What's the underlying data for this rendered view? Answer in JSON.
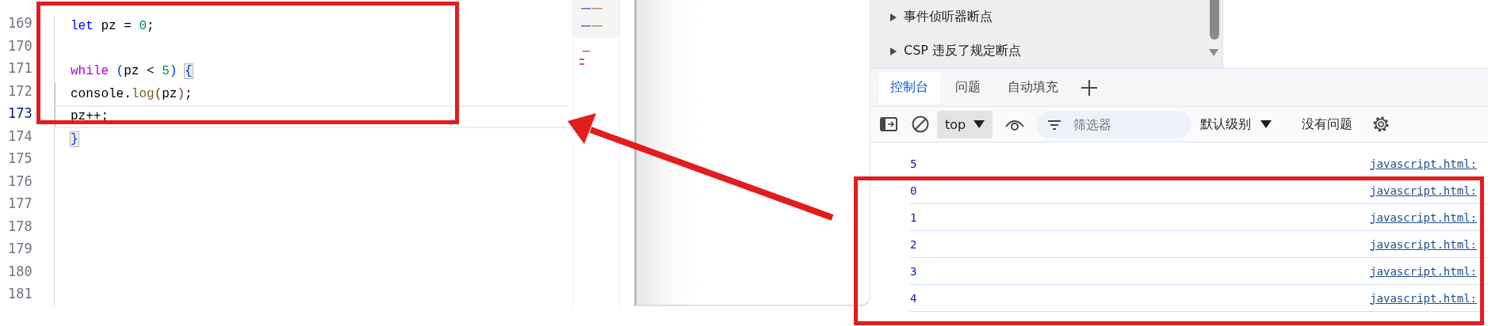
{
  "editor": {
    "lines": [
      {
        "number": "169",
        "active": false,
        "indent": false,
        "tokens": [
          {
            "kind": "keyword",
            "text": "let"
          },
          {
            "kind": "plain",
            "text": " pz = "
          },
          {
            "kind": "number",
            "text": "0"
          },
          {
            "kind": "plain",
            "text": ";"
          }
        ]
      },
      {
        "number": "170",
        "active": false,
        "indent": false
      },
      {
        "number": "171",
        "active": false,
        "indent": false,
        "tokens": [
          {
            "kind": "control",
            "text": "while"
          },
          {
            "kind": "bracket1",
            "text": " ("
          },
          {
            "kind": "plain",
            "text": "pz < "
          },
          {
            "kind": "number",
            "text": "5"
          },
          {
            "kind": "bracket1",
            "text": ") "
          },
          {
            "kind": "bracket-match",
            "text": "{"
          }
        ]
      },
      {
        "number": "172",
        "active": false,
        "indent": true,
        "tokens": [
          {
            "kind": "plain",
            "text": "console."
          },
          {
            "kind": "function",
            "text": "log"
          },
          {
            "kind": "bracket2",
            "text": "("
          },
          {
            "kind": "plain",
            "text": "pz"
          },
          {
            "kind": "bracket2",
            "text": ")"
          },
          {
            "kind": "plain",
            "text": ";"
          }
        ]
      },
      {
        "number": "173",
        "active": true,
        "indent": true,
        "tokens": [
          {
            "kind": "plain",
            "text": "pz++;"
          }
        ]
      },
      {
        "number": "174",
        "active": false,
        "indent": false,
        "tokens": [
          {
            "kind": "bracket-match",
            "text": "}"
          }
        ]
      },
      {
        "number": "175",
        "active": false,
        "indent": false
      },
      {
        "number": "176",
        "active": false,
        "indent": false
      },
      {
        "number": "177",
        "active": false,
        "indent": false
      },
      {
        "number": "178",
        "active": false,
        "indent": false
      },
      {
        "number": "179",
        "active": false,
        "indent": false
      },
      {
        "number": "180",
        "active": false,
        "indent": false
      },
      {
        "number": "181",
        "active": false,
        "indent": false
      }
    ]
  },
  "devtools": {
    "breakpoints": [
      {
        "label": "事件侦听器断点",
        "expanded": false
      },
      {
        "label": "CSP 违反了规定断点",
        "expanded": false
      }
    ],
    "tabs": [
      {
        "label": "控制台",
        "selected": true
      },
      {
        "label": "问题",
        "selected": false
      },
      {
        "label": "自动填充",
        "selected": false
      }
    ],
    "toolbar": {
      "context": "top",
      "filter": {
        "placeholder": "筛选器"
      },
      "level": "默认级别",
      "issues": "没有问题"
    },
    "console": [
      {
        "value": "5",
        "source": "javascript.html:"
      },
      {
        "value": "0",
        "source": "javascript.html:"
      },
      {
        "value": "1",
        "source": "javascript.html:"
      },
      {
        "value": "2",
        "source": "javascript.html:"
      },
      {
        "value": "3",
        "source": "javascript.html:"
      },
      {
        "value": "4",
        "source": "javascript.html:"
      }
    ]
  }
}
